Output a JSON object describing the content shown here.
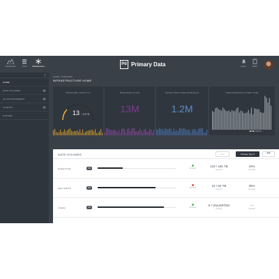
{
  "topbar": {
    "nav": [
      {
        "label": "Dashboard",
        "icon": "mountain-icon"
      },
      {
        "label": "Tools",
        "icon": "stack-icon"
      },
      {
        "label": "Infrastructure",
        "icon": "asterisk-icon"
      }
    ],
    "brand_logo": "Pd",
    "brand_name": "Primary Data",
    "right_icons": [
      {
        "label": "Alerts",
        "icon": "bell-icon"
      },
      {
        "label": "Tasks",
        "icon": "clipboard-icon"
      }
    ]
  },
  "sidebar": {
    "items": [
      {
        "label": "HOME",
        "count": ""
      },
      {
        "label": "DATA VOLUMES",
        "count": "3"
      },
      {
        "label": "ALLOW MOVEMENT",
        "count": "0"
      },
      {
        "label": "CLIENTS",
        "count": "0"
      },
      {
        "label": "SYSTEM",
        "count": ""
      }
    ]
  },
  "content": {
    "breadcrumb": "HOME  ›  OVERVIEW",
    "title": "INFRASTRUCTURE HOME",
    "metrics": {
      "capacity": {
        "title": "MANAGED CAPACITY",
        "value": "13",
        "unit": "/ 54TB",
        "gauge_fraction": 0.24
      },
      "files": {
        "title": "MANAGED FILES",
        "value": "13M"
      },
      "performance": {
        "title": "DIRECTORS PERFORMANCE",
        "value": "1.2M"
      },
      "overtime": {
        "title": "PERFORMANCE OVER TIME",
        "legend_value": "30 M",
        "legend_text": "IOPS/s ...",
        "level_fraction": 0.4
      }
    }
  },
  "volumes": {
    "title": "DATA VOLUMES",
    "ghost_button": "Filter",
    "storage_button": "Storage Type  ▾",
    "more_button": "•••",
    "rows": [
      {
        "name": "NetApp Trinity",
        "toggle": "ON",
        "fill": 0.32,
        "status": "All Good",
        "status_color": "#5cb85c",
        "cap": "119 / 165 TB",
        "cap_sub": "Capacity",
        "pct": "23%",
        "pct_sub": "Available"
      },
      {
        "name": "Isilon OnE FS",
        "toggle": "ON",
        "fill": 0.74,
        "status": "Warning",
        "status_color": "#d9534f",
        "cap": "31 / 60 TB",
        "cap_sub": "Capacity",
        "pct": "25%",
        "pct_sub": "Available"
      },
      {
        "name": "Amazon",
        "toggle": "ON",
        "fill": 0.85,
        "status": "All Good",
        "status_color": "#5cb85c",
        "cap": "5 / UNLIMITED",
        "cap_sub": "Capacity",
        "pct": "---",
        "pct_sub": "Available"
      }
    ]
  },
  "colors": {
    "gauge_arc": "#f2b035",
    "capacity_bars": "#d8a32c",
    "files_text": "#7b3a8f",
    "files_bars": "#8a4aa0",
    "perf_text": "#5a8ccf",
    "perf_bars": "#4a78b8",
    "time_bars": "#9aa1a8"
  }
}
